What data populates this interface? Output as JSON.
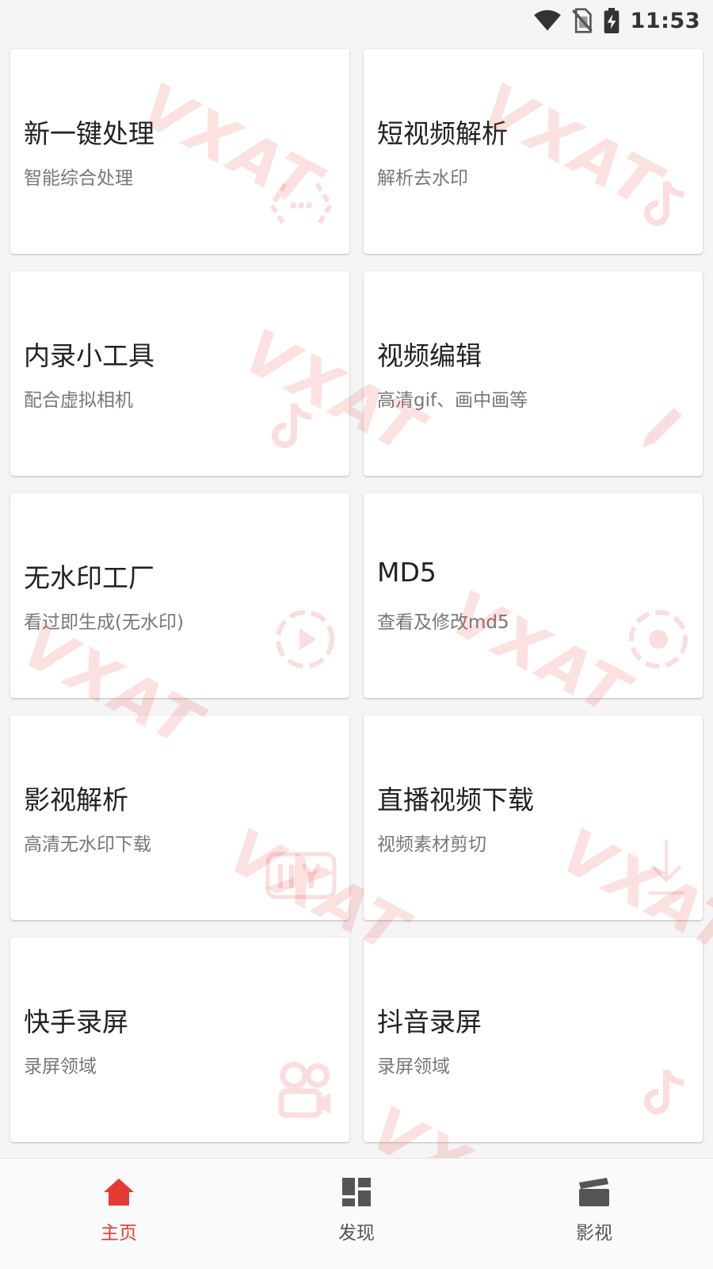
{
  "status_bar": {
    "time": "11:53",
    "icons": [
      "wifi-icon",
      "no-sim-icon",
      "battery-charging-icon"
    ]
  },
  "cards": [
    {
      "title": "新一键处理",
      "subtitle": "智能综合处理",
      "icon": "code-brackets-icon"
    },
    {
      "title": "短视频解析",
      "subtitle": "解析去水印",
      "icon": "music-note-icon"
    },
    {
      "title": "内录小工具",
      "subtitle": "配合虚拟相机",
      "icon": "music-note-icon"
    },
    {
      "title": "视频编辑",
      "subtitle": "高清gif、画中画等",
      "icon": "pencil-icon"
    },
    {
      "title": "无水印工厂",
      "subtitle": "看过即生成(无水印)",
      "icon": "play-circle-icon"
    },
    {
      "title": "MD5",
      "subtitle": "查看及修改md5",
      "icon": "target-icon"
    },
    {
      "title": "影视解析",
      "subtitle": "高清无水印下载",
      "icon": "iqiyi-icon"
    },
    {
      "title": "直播视频下载",
      "subtitle": "视频素材剪切",
      "icon": "download-icon"
    },
    {
      "title": "快手录屏",
      "subtitle": "录屏领域",
      "icon": "kuaishou-icon"
    },
    {
      "title": "抖音录屏",
      "subtitle": "录屏领域",
      "icon": "music-note-icon"
    }
  ],
  "bottom_nav": [
    {
      "label": "主页",
      "icon": "home-icon",
      "active": true
    },
    {
      "label": "发现",
      "icon": "dashboard-icon",
      "active": false
    },
    {
      "label": "影视",
      "icon": "clapperboard-icon",
      "active": false
    }
  ],
  "watermark": {
    "text": "VXAT",
    "color": "#eb4646"
  },
  "colors": {
    "accent": "#e53935",
    "background": "#f5f5f5",
    "card": "#ffffff"
  }
}
